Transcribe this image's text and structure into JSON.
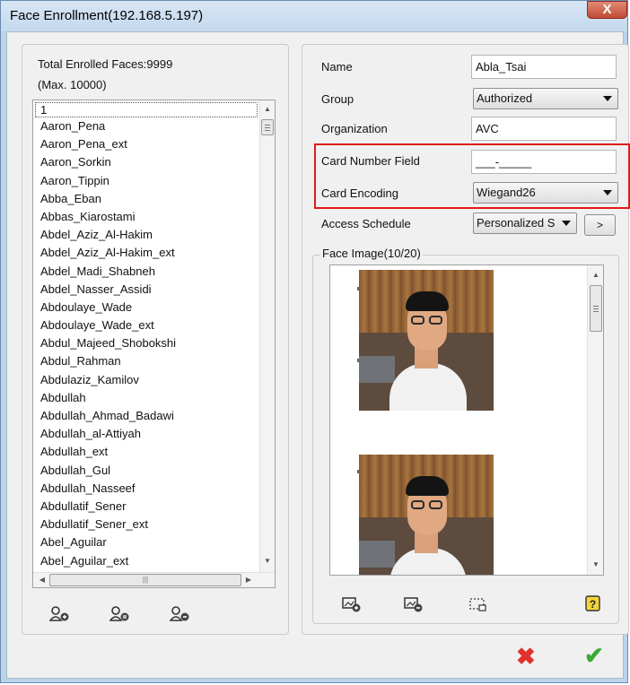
{
  "window": {
    "title": "Face Enrollment(192.168.5.197)",
    "close_glyph": "X"
  },
  "left_panel": {
    "total_label": "Total Enrolled Faces:9999",
    "max_label": "(Max. 10000)",
    "list_items": [
      "1",
      "Aaron_Pena",
      "Aaron_Pena_ext",
      "Aaron_Sorkin",
      "Aaron_Tippin",
      "Abba_Eban",
      "Abbas_Kiarostami",
      "Abdel_Aziz_Al-Hakim",
      "Abdel_Aziz_Al-Hakim_ext",
      "Abdel_Madi_Shabneh",
      "Abdel_Nasser_Assidi",
      "Abdoulaye_Wade",
      "Abdoulaye_Wade_ext",
      "Abdul_Majeed_Shobokshi",
      "Abdul_Rahman",
      "Abdulaziz_Kamilov",
      "Abdullah",
      "Abdullah_Ahmad_Badawi",
      "Abdullah_al-Attiyah",
      "Abdullah_ext",
      "Abdullah_Gul",
      "Abdullah_Nasseef",
      "Abdullatif_Sener",
      "Abdullatif_Sener_ext",
      "Abel_Aguilar",
      "Abel_Aguilar_ext"
    ],
    "buttons": {
      "add_user_icon": "add-user-icon",
      "edit_user_icon": "edit-user-icon",
      "delete_user_icon": "delete-user-icon"
    }
  },
  "form": {
    "name_label": "Name",
    "name_value": "Abla_Tsai",
    "group_label": "Group",
    "group_value": "Authorized",
    "organization_label": "Organization",
    "organization_value": "AVC",
    "card_number_label": "Card Number Field",
    "card_number_value": "___-_____",
    "card_encoding_label": "Card Encoding",
    "card_encoding_value": "Wiegand26",
    "access_schedule_label": "Access Schedule",
    "access_schedule_value": "Personalized S",
    "schedule_more_label": ">",
    "face_image_label": "Face Image(10/20)"
  },
  "face_image_toolbar": {
    "add_image_icon": "add-image-icon",
    "remove_image_icon": "remove-image-icon",
    "crop_image_icon": "crop-image-icon",
    "help_icon": "help-icon"
  },
  "dialog_actions": {
    "cancel_glyph": "✖",
    "confirm_glyph": "✔"
  },
  "colors": {
    "highlight_frame": "#e01b1b",
    "cancel": "#e0322b",
    "confirm": "#3aaa35"
  }
}
